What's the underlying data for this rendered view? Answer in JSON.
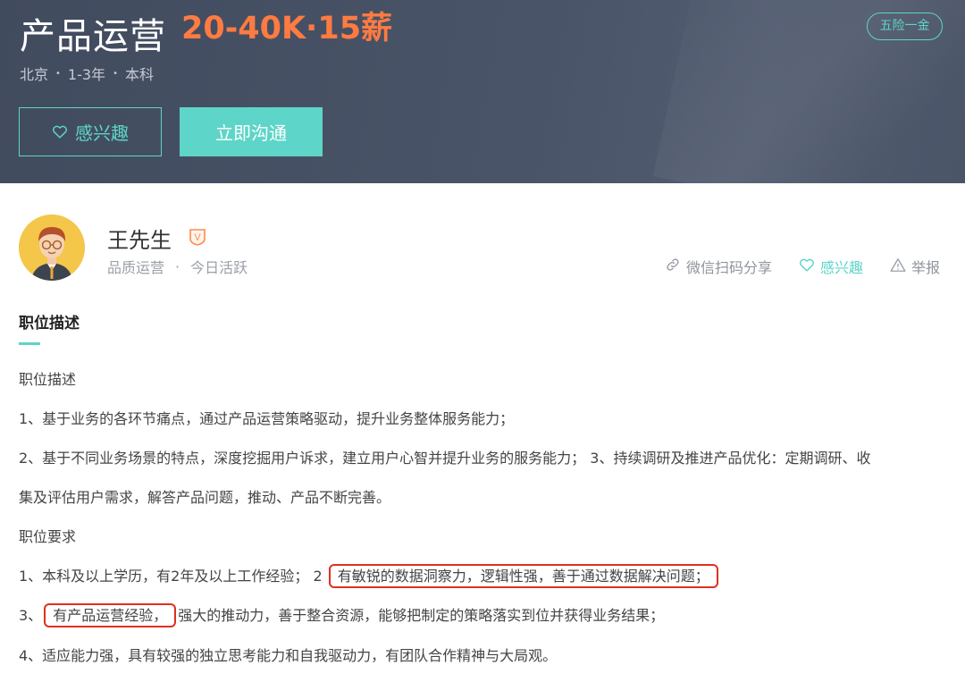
{
  "header": {
    "title": "产品运营",
    "salary": "20-40K·15薪",
    "welfare": "五险一金",
    "location": "北京",
    "experience": "1-3年",
    "education": "本科",
    "interest_label": "感兴趣",
    "chat_label": "立即沟通"
  },
  "recruiter": {
    "name": "王先生",
    "badge": "V",
    "role": "品质运营",
    "status": "今日活跃",
    "share_label": "微信扫码分享",
    "interest_label": "感兴趣",
    "report_label": "举报"
  },
  "description": {
    "heading": "职位描述",
    "lines": [
      "职位描述",
      "1、基于业务的各环节痛点，通过产品运营策略驱动，提升业务整体服务能力；",
      "2、基于不同业务场景的特点，深度挖掘用户诉求，建立用户心智并提升业务的服务能力； 3、持续调研及推进产品优化：定期调研、收",
      "集及评估用户需求，解答产品问题，推动、产品不断完善。",
      "职位要求"
    ],
    "req1_prefix": "1、本科及以上学历，有2年及以上工作经验； 2",
    "req1_highlight": "有敏锐的数据洞察力，逻辑性强，善于通过数据解决问题；",
    "req2_prefix": "3、",
    "req2_highlight": "有产品运营经验，",
    "req2_suffix": "强大的推动力，善于整合资源，能够把制定的策略落实到位并获得业务结果；",
    "req3": "4、适应能力强，具有较强的独立思考能力和自我驱动力，有团队合作精神与大局观。"
  },
  "colors": {
    "accent": "#5dd5c8",
    "salary": "#ff7b41",
    "highlight_border": "#e0301e",
    "banner": "#464f63"
  },
  "icons": [
    "heart-icon",
    "link-icon",
    "warning-icon",
    "verified-icon",
    "avatar"
  ]
}
